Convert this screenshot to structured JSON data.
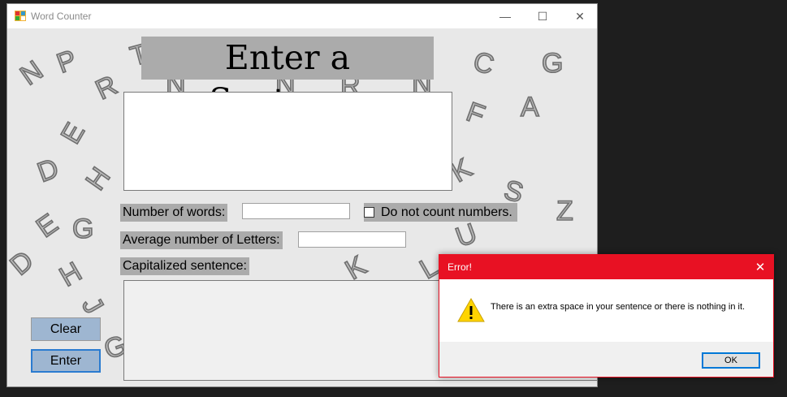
{
  "window": {
    "title": "Word Counter",
    "controls": {
      "minimize": "—",
      "maximize": "☐",
      "close": "✕"
    }
  },
  "background_letters": [
    "N",
    "P",
    "R",
    "T",
    "N",
    "N",
    "R",
    "N",
    "C",
    "G",
    "F",
    "A",
    "E",
    "D",
    "H",
    "K",
    "S",
    "Z",
    "E",
    "G",
    "U",
    "D",
    "H",
    "K",
    "L",
    "G",
    "J"
  ],
  "form": {
    "heading": "Enter a Sentence",
    "sentence_input": "",
    "words_label": "Number of words:",
    "words_value": "",
    "no_numbers_label": "Do not count numbers.",
    "no_numbers_checked": false,
    "avg_letters_label": "Average number of Letters:",
    "avg_letters_value": "",
    "capitalized_label": "Capitalized sentence:",
    "capitalized_value": "",
    "clear_label": "Clear",
    "enter_label": "Enter"
  },
  "dialog": {
    "title": "Error!",
    "message": "There is an extra space in your sentence or there is nothing in it.",
    "ok_label": "OK",
    "close": "✕",
    "icon": "warning-icon"
  },
  "colors": {
    "dialog_accent": "#e81123",
    "button_fill": "#9eb6d1",
    "label_bg": "#ababab",
    "focus_border": "#0078d7"
  }
}
